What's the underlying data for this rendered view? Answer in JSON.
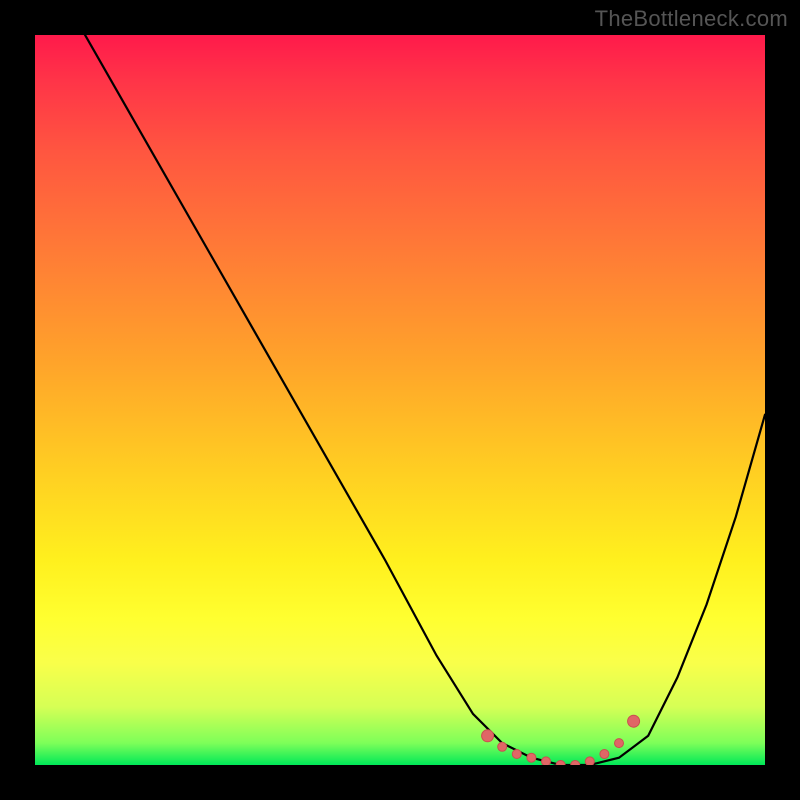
{
  "watermark": "TheBottleneck.com",
  "colors": {
    "page_bg": "#000000",
    "curve_stroke": "#000000",
    "marker_fill": "#e06666",
    "marker_stroke": "#c94f4f"
  },
  "chart_data": {
    "type": "line",
    "title": "",
    "xlabel": "",
    "ylabel": "",
    "xlim": [
      0,
      100
    ],
    "ylim": [
      0,
      100
    ],
    "grid": false,
    "legend": false,
    "series": [
      {
        "name": "bottleneck-curve",
        "x": [
          0,
          8,
          16,
          24,
          32,
          40,
          48,
          55,
          60,
          64,
          68,
          72,
          76,
          80,
          84,
          88,
          92,
          96,
          100
        ],
        "values": [
          112,
          98,
          84,
          70,
          56,
          42,
          28,
          15,
          7,
          3,
          1,
          0,
          0,
          1,
          4,
          12,
          22,
          34,
          48
        ]
      }
    ],
    "markers": {
      "name": "highlight-range",
      "x": [
        62,
        64,
        66,
        68,
        70,
        72,
        74,
        76,
        78,
        80,
        82
      ],
      "values": [
        4,
        2.5,
        1.5,
        1,
        0.5,
        0,
        0,
        0.5,
        1.5,
        3,
        6
      ]
    },
    "gradient_stops": [
      {
        "pct": 0,
        "color": "#ff1a4b"
      },
      {
        "pct": 30,
        "color": "#ff7c36"
      },
      {
        "pct": 60,
        "color": "#ffcf22"
      },
      {
        "pct": 85,
        "color": "#f0ff40"
      },
      {
        "pct": 100,
        "color": "#00e858"
      }
    ]
  }
}
